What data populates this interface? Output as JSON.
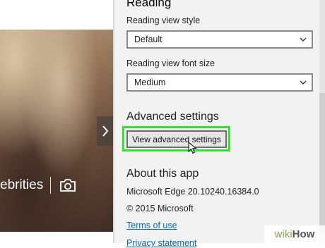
{
  "background": {
    "caption": "ebrities"
  },
  "reading": {
    "heading": "Reading",
    "style_label": "Reading view style",
    "style_value": "Default",
    "font_label": "Reading view font size",
    "font_value": "Medium"
  },
  "advanced": {
    "heading": "Advanced settings",
    "button_label": "View advanced settings",
    "highlight_color": "#2fe62f"
  },
  "about": {
    "heading": "About this app",
    "version": "Microsoft Edge 20.10240.16384.0",
    "copyright": "© 2015 Microsoft",
    "terms_link": "Terms of use",
    "privacy_link": "Privacy statement"
  },
  "watermark": {
    "wiki": "wiki",
    "how": "How"
  },
  "colors": {
    "pane_bg": "#f2f2f2",
    "link": "#0a67b8"
  }
}
